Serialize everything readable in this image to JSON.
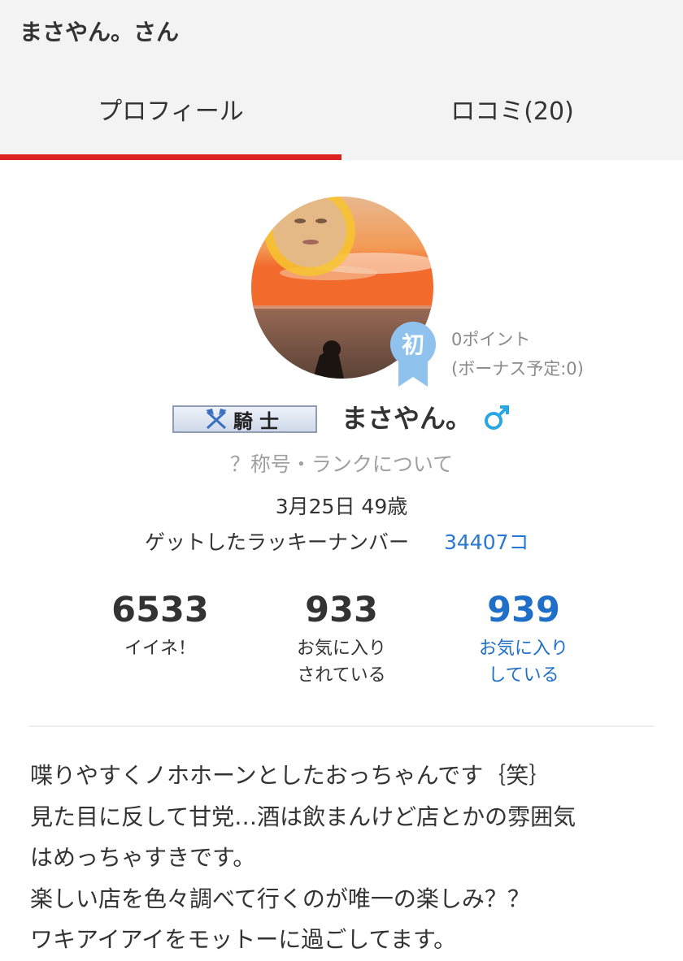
{
  "header": {
    "title": "まさやん。さん"
  },
  "tabs": [
    {
      "label": "プロフィール",
      "active": true
    },
    {
      "label": "ロコミ(20)",
      "active": false
    }
  ],
  "profile": {
    "badge_char": "初",
    "points": "0ポイント",
    "bonus": "(ボーナス予定:0)",
    "rank_label": "騎士",
    "rank_icon": "crossed-axes-icon",
    "nickname": "まさやん。",
    "gender_icon": "male-symbol-icon",
    "rank_help_link": "？称号・ランクについて",
    "birthday_age": "3月25日 49歳",
    "lucky_label": "ゲットしたラッキーナンバー",
    "lucky_value": "34407コ"
  },
  "stats": [
    {
      "value": "6533",
      "label": "イイネ！"
    },
    {
      "value": "933",
      "label": "お気に入り\nされている"
    },
    {
      "value": "939",
      "label": "お気に入り\nしている"
    }
  ],
  "bio": [
    "喋りやすくノホホーンとしたおっちゃんです｛笑｝",
    "見た目に反して甘党…酒は飲まんけど店とかの雰囲気",
    "はめっちゃすきです。",
    "楽しい店を色々調べて行くのが唯一の楽しみ？？",
    "ワキアイアイをモットーに過ごしてます。"
  ],
  "colors": {
    "accent": "#dd2222",
    "link": "#2a78d6",
    "badge": "#8fc3ee"
  }
}
